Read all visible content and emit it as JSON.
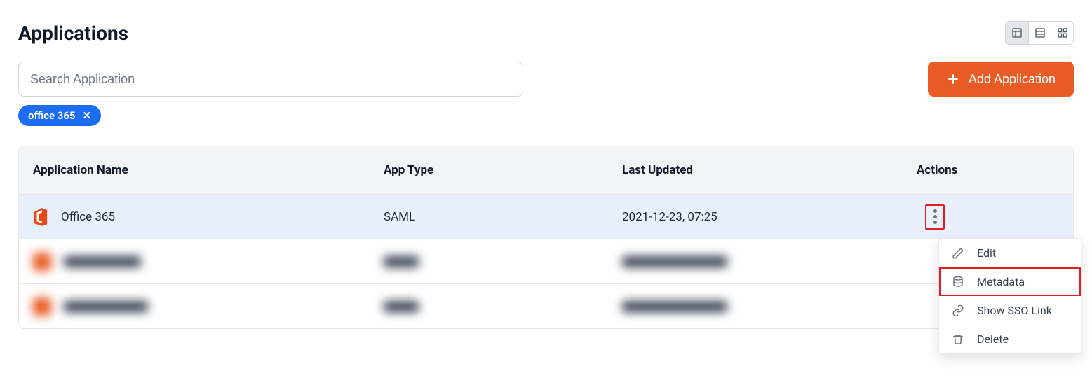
{
  "page_title": "Applications",
  "search": {
    "placeholder": "Search Application"
  },
  "filter_chip": {
    "label": "office 365"
  },
  "add_button": {
    "label": "Add Application"
  },
  "table": {
    "headers": {
      "name": "Application Name",
      "type": "App Type",
      "updated": "Last Updated",
      "actions": "Actions"
    },
    "rows": [
      {
        "name": "Office 365",
        "type": "SAML",
        "updated": "2021-12-23, 07:25"
      }
    ]
  },
  "dropdown": {
    "edit": "Edit",
    "metadata": "Metadata",
    "sso": "Show SSO Link",
    "delete": "Delete"
  }
}
